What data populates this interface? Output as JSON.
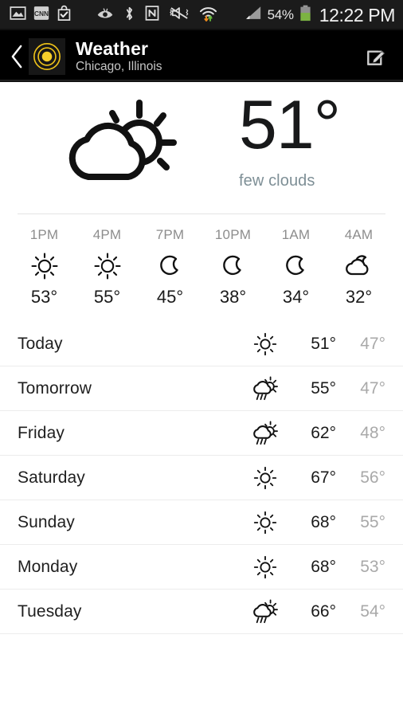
{
  "status_bar": {
    "icons": [
      "gallery-icon",
      "cnn-icon",
      "play-store-bag-icon",
      "smart-stay-eye-icon",
      "bluetooth-icon",
      "nfc-icon",
      "vibrate-mute-icon",
      "wifi-transfer-icon",
      "cell-signal-icon"
    ],
    "battery_percent": "54%",
    "battery_icon": "battery-icon",
    "battery_color": "#7cb342",
    "time": "12:22 PM"
  },
  "action_bar": {
    "back_icon": "back-chevron-icon",
    "app_icon": "weather-sun-app-icon",
    "app_icon_color": "#f5c518",
    "title": "Weather",
    "subtitle": "Chicago, Illinois",
    "edit_icon": "edit-compose-icon"
  },
  "current": {
    "icon": "partly-cloudy-day-icon",
    "temperature": "51°",
    "summary": "few clouds"
  },
  "hourly": [
    {
      "time": "1PM",
      "icon": "sun-icon",
      "temp": "53°"
    },
    {
      "time": "4PM",
      "icon": "sun-icon",
      "temp": "55°"
    },
    {
      "time": "7PM",
      "icon": "moon-icon",
      "temp": "45°"
    },
    {
      "time": "10PM",
      "icon": "moon-icon",
      "temp": "38°"
    },
    {
      "time": "1AM",
      "icon": "moon-icon",
      "temp": "34°"
    },
    {
      "time": "4AM",
      "icon": "cloudy-night-icon",
      "temp": "32°"
    }
  ],
  "daily": [
    {
      "day": "Today",
      "icon": "sun-icon",
      "high": "51°",
      "low": "47°"
    },
    {
      "day": "Tomorrow",
      "icon": "sun-shower-icon",
      "high": "55°",
      "low": "47°"
    },
    {
      "day": "Friday",
      "icon": "sun-shower-icon",
      "high": "62°",
      "low": "48°"
    },
    {
      "day": "Saturday",
      "icon": "sun-icon",
      "high": "67°",
      "low": "56°"
    },
    {
      "day": "Sunday",
      "icon": "sun-icon",
      "high": "68°",
      "low": "55°"
    },
    {
      "day": "Monday",
      "icon": "sun-icon",
      "high": "68°",
      "low": "53°"
    },
    {
      "day": "Tuesday",
      "icon": "sun-shower-icon",
      "high": "66°",
      "low": "54°"
    }
  ],
  "colors": {
    "status_bar_bg": "#1b1b1b",
    "action_bar_bg": "#000000",
    "page_bg": "#ffffff",
    "summary_text": "#7e8f96",
    "low_temp_text": "#a9a9a9"
  }
}
